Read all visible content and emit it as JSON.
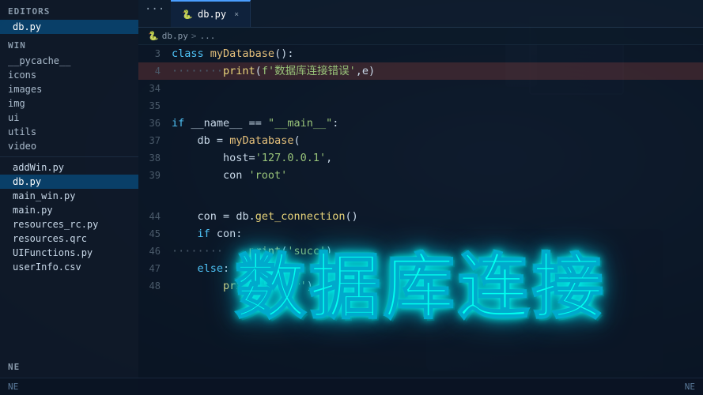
{
  "sidebar": {
    "editors_label": "EDITORS",
    "win_label": "WIN",
    "active_file": "db.py",
    "editors_files": [
      {
        "name": "db.py",
        "active": true
      }
    ],
    "win_folders": [
      {
        "name": "__pycache__",
        "is_folder": true
      },
      {
        "name": "icons",
        "is_folder": true
      },
      {
        "name": "images",
        "is_folder": true
      },
      {
        "name": "img",
        "is_folder": true
      },
      {
        "name": "ui",
        "is_folder": true
      },
      {
        "name": "utils",
        "is_folder": true
      },
      {
        "name": "video",
        "is_folder": true
      }
    ],
    "win_files": [
      {
        "name": "addWin.py"
      },
      {
        "name": "db.py",
        "active": true
      },
      {
        "name": "main_win.py"
      },
      {
        "name": "main.py"
      },
      {
        "name": "resources_rc.py"
      },
      {
        "name": "resources.qrc"
      },
      {
        "name": "UIFunctions.py"
      },
      {
        "name": "userInfo.csv"
      }
    ],
    "bottom_items": [
      "NE",
      "NE"
    ]
  },
  "tab_bar": {
    "ellipsis": "...",
    "tab_icon": "🐍",
    "tab_label": "db.py",
    "tab_close": "×"
  },
  "breadcrumb": {
    "file": "db.py",
    "separator": ">",
    "location": "..."
  },
  "code": {
    "lines": [
      {
        "num": "3",
        "content": "class myDatabase():"
      },
      {
        "num": "4",
        "content": "········print(f'数据库连接错误',e)",
        "highlight": true
      },
      {
        "num": "34",
        "content": ""
      },
      {
        "num": "35",
        "content": ""
      },
      {
        "num": "36",
        "content": "if __name__ == \"__main__\":"
      },
      {
        "num": "37",
        "content": "    db = myDatabase("
      },
      {
        "num": "38",
        "content": "        host='127.0.0.1',"
      },
      {
        "num": "39",
        "content": "        con 'root'"
      },
      {
        "num": "44",
        "content": "    con = db.get_connection()"
      },
      {
        "num": "45",
        "content": "    if con:"
      },
      {
        "num": "46",
        "content": "········    print('succ')"
      },
      {
        "num": "47",
        "content": "    else:"
      },
      {
        "num": "48",
        "content": "        print('error')"
      }
    ]
  },
  "big_title": {
    "text": "数据库连接"
  },
  "status_bar": {
    "left": "NE",
    "right": "NE"
  }
}
